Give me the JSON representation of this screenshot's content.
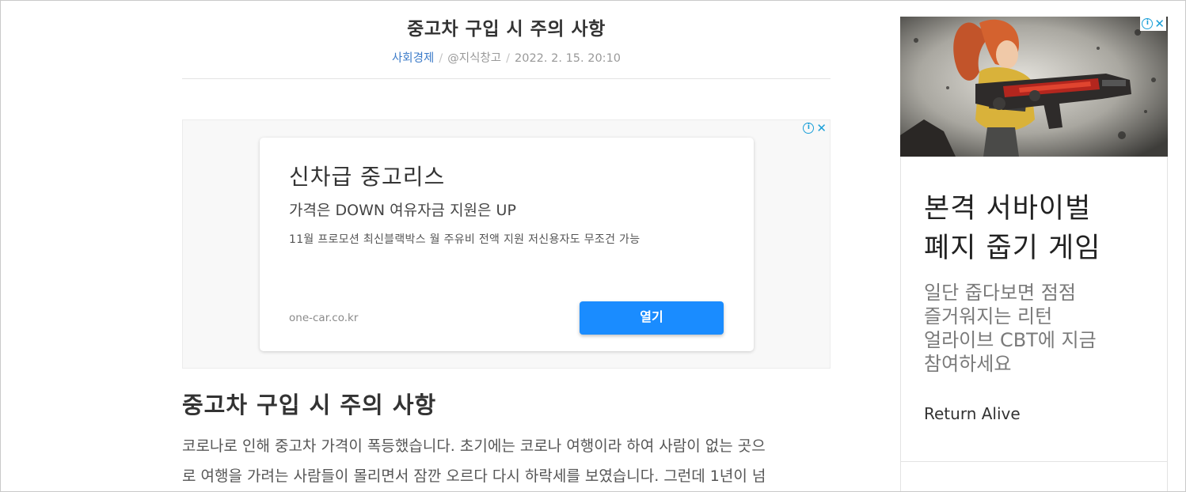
{
  "article": {
    "title": "중고차 구입 시 주의 사항",
    "category": "사회경제",
    "author": "@지식창고",
    "date": "2022. 2. 15. 20:10",
    "separator": "/",
    "section_heading": "중고차 구입 시 주의 사항",
    "paragraph_lines": [
      "코로나로 인해 중고차 가격이 폭등했습니다. 초기에는 코로나 여행이라 하여 사람이 없는 곳으",
      "로 여행을 가려는 사람들이 몰리면서 잠깐 오르다 다시 하락세를 보였습니다. 그런데 1년이 넘"
    ]
  },
  "inline_ad": {
    "headline": "신차급 중고리스",
    "subhead": "가격은 DOWN 여유자금 지원은 UP",
    "description": "11월 프로모션 최신블랙박스 월 주유비 전액 지원 저신용자도 무조건 가능",
    "domain": "one-car.co.kr",
    "open_label": "열기",
    "info_icon": "info-icon",
    "close_icon": "close-icon",
    "colors": {
      "button": "#1a8cff",
      "badge": "#1a9fd8"
    }
  },
  "sidebar_ad": {
    "title_lines": [
      "본격 서바이벌",
      "폐지 줍기 게임"
    ],
    "desc_lines": [
      "일단 줍다보면 점점",
      "즐거워지는 리턴",
      "얼라이브 CBT에 지금",
      "참여하세요"
    ],
    "brand": "Return Alive",
    "image_icon": "game-character-image",
    "info_icon": "info-icon",
    "close_icon": "close-icon"
  },
  "colors": {
    "category_link": "#3d7cc9",
    "meta_text": "#999999",
    "title_text": "#333333"
  }
}
